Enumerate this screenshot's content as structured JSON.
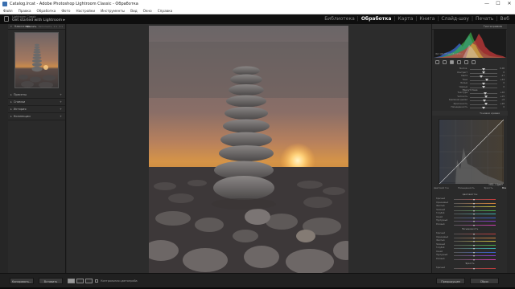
{
  "window": {
    "title": "Catalog.lrcat - Adobe Photoshop Lightroom Classic - Обработка",
    "controls": [
      "—",
      "☐",
      "✕"
    ]
  },
  "menu": [
    "Файл",
    "Правка",
    "Обработка",
    "Фото",
    "Настройки",
    "Инструменты",
    "Вид",
    "Окно",
    "Справка"
  ],
  "identity": {
    "subtitle": "Lightroom Classic",
    "title": "Get started with Lightroom ▸"
  },
  "modules": [
    {
      "label": "Библиотека",
      "active": false
    },
    {
      "label": "Обработка",
      "active": true
    },
    {
      "label": "Карта",
      "active": false
    },
    {
      "label": "Книга",
      "active": false
    },
    {
      "label": "Слайд-шоу",
      "active": false
    },
    {
      "label": "Печать",
      "active": false
    },
    {
      "label": "Веб",
      "active": false
    }
  ],
  "left_panel": {
    "navigator": {
      "label": "Навигатор",
      "tabs": [
        "Вписать",
        "Заполнить",
        "1:1",
        "3:1"
      ],
      "active_tab": "Вписать"
    },
    "sections": [
      "Пресеты",
      "Снимки",
      "История",
      "Коллекции"
    ]
  },
  "right_panel": {
    "histogram": {
      "label": "Гистограмма",
      "info": "ISO 100   35 мм   f/8   1/250 с",
      "colors": {
        "red": "#d23b3b",
        "green": "#3bb24a",
        "blue": "#3b6ed6",
        "yellow": "#e0d040",
        "white": "#e6e6e6"
      }
    },
    "basic_rows": [
      {
        "label": "Экспоз.",
        "pos": 0.5,
        "value": "0.00"
      },
      {
        "label": "Контраст",
        "pos": 0.5,
        "value": "0"
      },
      {
        "label": "Света",
        "pos": 0.4,
        "value": "-17"
      },
      {
        "label": "Тени",
        "pos": 0.62,
        "value": "+24"
      },
      {
        "label": "Белые",
        "pos": 0.5,
        "value": "0"
      },
      {
        "label": "Черные",
        "pos": 0.5,
        "value": "0"
      }
    ],
    "presence_label": "Присутствие",
    "presence_rows": [
      {
        "label": "Текстура",
        "pos": 0.55,
        "value": "+10"
      },
      {
        "label": "Четкость",
        "pos": 0.58,
        "value": "+15"
      },
      {
        "label": "Удаление дымки",
        "pos": 0.54,
        "value": "+8"
      },
      {
        "label": "Красочность",
        "pos": 0.6,
        "value": "+20"
      },
      {
        "label": "Насыщенность",
        "pos": 0.5,
        "value": "0"
      }
    ],
    "tone_curve_label": "Тоновая кривая",
    "hsl": {
      "label": "HSL / Цвет",
      "tabs": [
        "Цветовой тон",
        "Насыщенность",
        "Яркость",
        "Все"
      ],
      "active_tab": "Все",
      "groups": [
        {
          "title": "Цветовой тон",
          "rows": [
            "Красный",
            "Оранжевый",
            "Желтый",
            "Зеленый",
            "Голубой",
            "Синий",
            "Пурпурный",
            "Розовый"
          ]
        },
        {
          "title": "Насыщенность",
          "rows": [
            "Красный",
            "Оранжевый",
            "Желтый",
            "Зеленый",
            "Голубой",
            "Синий",
            "Пурпурный",
            "Розовый"
          ]
        },
        {
          "title": "Яркость",
          "rows": [
            "Красный"
          ]
        }
      ],
      "track_colors": [
        "#c43c3c",
        "#d2813a",
        "#d2c43a",
        "#4ab24a",
        "#3ab2b2",
        "#3a62d2",
        "#8a3ad2",
        "#d23ab2"
      ]
    }
  },
  "bottom": {
    "copy_label": "Копировать...",
    "paste_label": "Вставить",
    "softproof_label": "Контрольная цветопроба",
    "previous_label": "Предыдущее",
    "reset_label": "Сброс"
  }
}
